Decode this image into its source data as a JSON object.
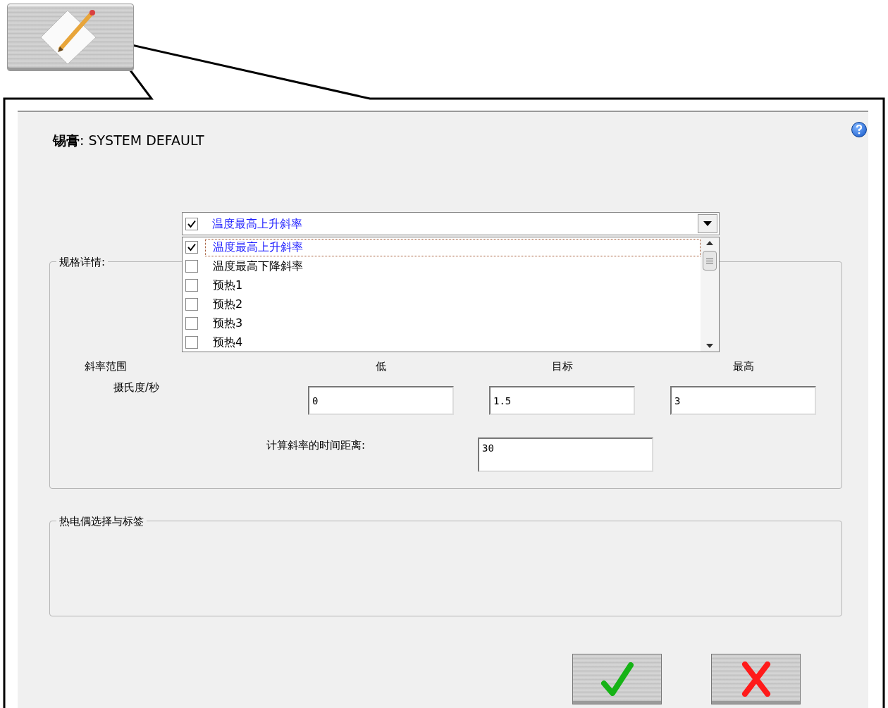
{
  "title": "**锡膏**: SYSTEM DEFAULT",
  "combo": {
    "checked": true,
    "value": "温度最高上升斜率"
  },
  "dropdown_items": [
    {
      "label": "温度最高上升斜率",
      "checked": true,
      "selected": true
    },
    {
      "label": "温度最高下降斜率",
      "checked": false,
      "selected": false
    },
    {
      "label": "预热1",
      "checked": false,
      "selected": false
    },
    {
      "label": "预热2",
      "checked": false,
      "selected": false
    },
    {
      "label": "预热3",
      "checked": false,
      "selected": false
    },
    {
      "label": "预热4",
      "checked": false,
      "selected": false
    }
  ],
  "spec_group": {
    "title": "规格详情:",
    "range_label": "斜率范围",
    "unit_label": "摄氏度/秒",
    "columns": [
      {
        "label": "低",
        "value": "0"
      },
      {
        "label": "目标",
        "value": "1.5"
      },
      {
        "label": "最高",
        "value": "3"
      }
    ],
    "interval_label": "计算斜率的时间距离:",
    "interval_value": "30"
  },
  "thermocouple_group": {
    "title": "热电偶选择与标签"
  },
  "buttons": [
    {
      "kind": "ok"
    },
    {
      "kind": "cancel"
    }
  ]
}
